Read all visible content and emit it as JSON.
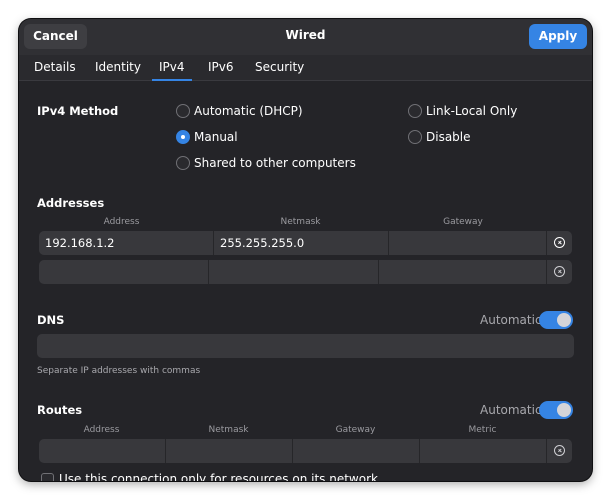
{
  "header": {
    "cancel_label": "Cancel",
    "title": "Wired",
    "apply_label": "Apply"
  },
  "tabs": [
    {
      "label": "Details",
      "active": false
    },
    {
      "label": "Identity",
      "active": false
    },
    {
      "label": "IPv4",
      "active": true
    },
    {
      "label": "IPv6",
      "active": false
    },
    {
      "label": "Security",
      "active": false
    }
  ],
  "method": {
    "label": "IPv4 Method",
    "options": [
      {
        "label": "Automatic (DHCP)",
        "checked": false
      },
      {
        "label": "Link-Local Only",
        "checked": false
      },
      {
        "label": "Manual",
        "checked": true
      },
      {
        "label": "Disable",
        "checked": false
      },
      {
        "label": "Shared to other computers",
        "checked": false
      }
    ]
  },
  "addresses": {
    "label": "Addresses",
    "columns": [
      "Address",
      "Netmask",
      "Gateway"
    ],
    "rows": [
      {
        "address": "192.168.1.2",
        "netmask": "255.255.255.0",
        "gateway": ""
      },
      {
        "address": "",
        "netmask": "",
        "gateway": ""
      }
    ]
  },
  "dns": {
    "label": "DNS",
    "automatic_label": "Automatic",
    "automatic_on": true,
    "value": "",
    "hint": "Separate IP addresses with commas"
  },
  "routes": {
    "label": "Routes",
    "automatic_label": "Automatic",
    "automatic_on": true,
    "columns": [
      "Address",
      "Netmask",
      "Gateway",
      "Metric"
    ],
    "rows": [
      {
        "address": "",
        "netmask": "",
        "gateway": "",
        "metric": ""
      }
    ]
  },
  "only_local_resources": {
    "label": "Use this connection only for resources on its network",
    "checked": false
  },
  "colors": {
    "accent": "#3584e4",
    "window_bg": "#242428",
    "entry_bg": "#38383c"
  }
}
